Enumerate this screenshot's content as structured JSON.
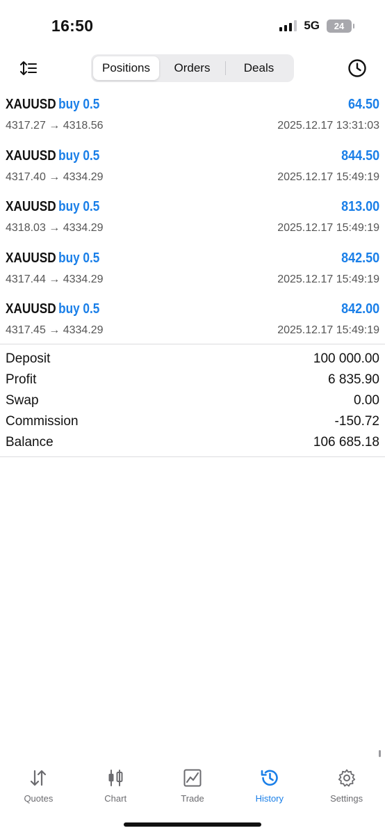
{
  "status_bar": {
    "time": "16:50",
    "network": "5G",
    "battery": "24"
  },
  "toolbar": {
    "tabs": [
      {
        "label": "Positions",
        "active": true
      },
      {
        "label": "Orders",
        "active": false
      },
      {
        "label": "Deals",
        "active": false
      }
    ]
  },
  "positions": [
    {
      "symbol": "XAUUSD",
      "side": "buy 0.5",
      "profit": "64.50",
      "prices": "4317.27 → 4318.56",
      "time": "2025.12.17 13:31:03"
    },
    {
      "symbol": "XAUUSD",
      "side": "buy 0.5",
      "profit": "844.50",
      "prices": "4317.40 → 4334.29",
      "time": "2025.12.17 15:49:19"
    },
    {
      "symbol": "XAUUSD",
      "side": "buy 0.5",
      "profit": "813.00",
      "prices": "4318.03 → 4334.29",
      "time": "2025.12.17 15:49:19"
    },
    {
      "symbol": "XAUUSD",
      "side": "buy 0.5",
      "profit": "842.50",
      "prices": "4317.44 → 4334.29",
      "time": "2025.12.17 15:49:19"
    },
    {
      "symbol": "XAUUSD",
      "side": "buy 0.5",
      "profit": "842.00",
      "prices": "4317.45 → 4334.29",
      "time": "2025.12.17 15:49:19"
    }
  ],
  "summary": [
    {
      "label": "Deposit",
      "value": "100 000.00"
    },
    {
      "label": "Profit",
      "value": "6 835.90"
    },
    {
      "label": "Swap",
      "value": "0.00"
    },
    {
      "label": "Commission",
      "value": "-150.72"
    },
    {
      "label": "Balance",
      "value": "106 685.18"
    }
  ],
  "tabbar": [
    {
      "label": "Quotes",
      "icon": "quotes-arrows-icon",
      "active": false
    },
    {
      "label": "Chart",
      "icon": "candlestick-icon",
      "active": false
    },
    {
      "label": "Trade",
      "icon": "trade-chart-icon",
      "active": false
    },
    {
      "label": "History",
      "icon": "history-clock-icon",
      "active": true
    },
    {
      "label": "Settings",
      "icon": "gear-icon",
      "active": false
    }
  ],
  "colors": {
    "accent": "#1a7fe8",
    "text": "#111111",
    "muted": "#555555"
  }
}
